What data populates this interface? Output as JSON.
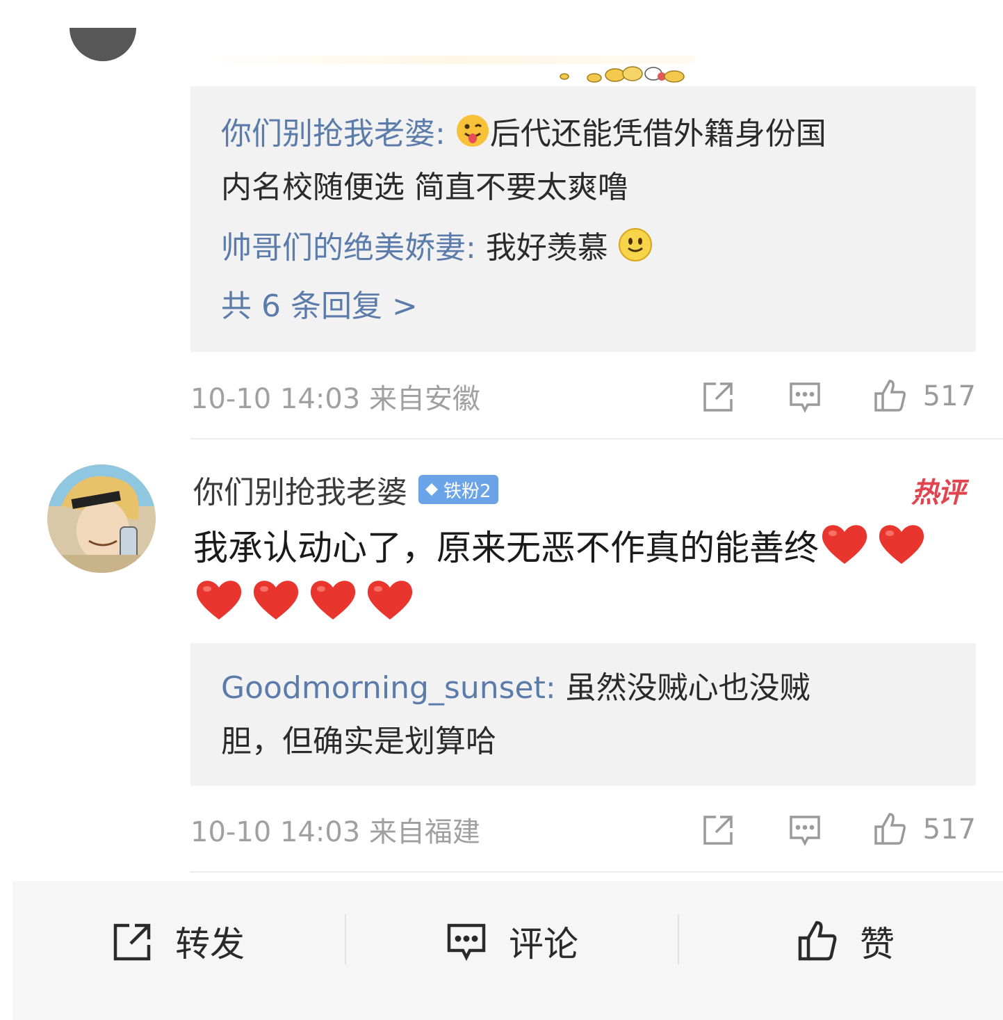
{
  "thread": {
    "replies_1": [
      {
        "user": "你们别抢我老婆",
        "sep": ": ",
        "emoji": "tongue-emoji",
        "text_a": "后代还能凭借外籍身份国",
        "text_b": "内名校随便选 简直不要太爽噜"
      },
      {
        "user": "帅哥们的绝美娇妻",
        "sep": ": ",
        "text": "我好羡慕",
        "emoji": "smile-emoji"
      }
    ],
    "more_replies": "共 6 条回复 >",
    "meta_1": {
      "time": "10-10 14:03",
      "location": "来自安徽",
      "likes": "517"
    }
  },
  "comment": {
    "user": "你们别抢我老婆",
    "badge": "铁粉2",
    "hot_tag": "热评",
    "text": "我承认动心了，原来无恶不作真的能善终",
    "hearts": 6,
    "reply": {
      "user": "Goodmorning_sunset",
      "sep": ": ",
      "text_a": "虽然没贼心也没贼",
      "text_b": "胆，但确实是划算哈"
    },
    "meta": {
      "time": "10-10 14:03",
      "location": "来自福建",
      "likes": "517"
    }
  },
  "bottom_bar": {
    "repost": "转发",
    "comment": "评论",
    "like": "赞"
  },
  "colors": {
    "link": "#5b7baa",
    "hot": "#e0444f",
    "badge": "#6aa3e8",
    "meta": "#a0a0a0",
    "reply_bg": "#f2f2f2"
  }
}
